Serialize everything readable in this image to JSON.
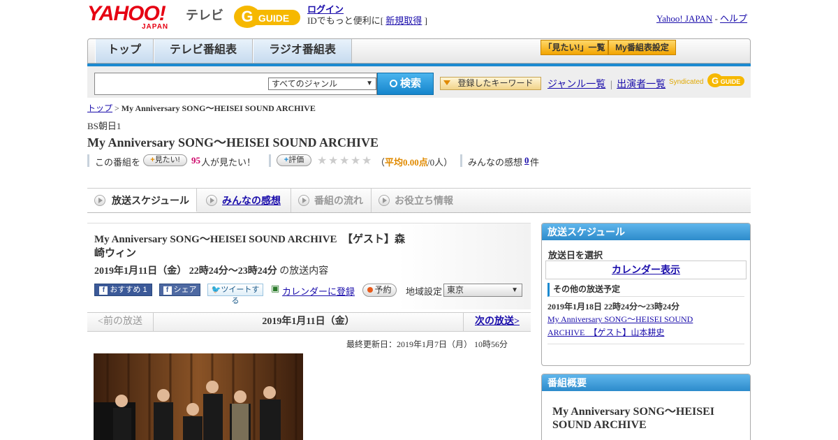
{
  "header": {
    "logo_text": "YAHOO!",
    "logo_sub": "JAPAN",
    "service_label": "テレビ",
    "gguide_label": "GUIDE",
    "login_link": "ログイン",
    "login_note_prefix": "IDでもっと便利に[",
    "signup_link": "新規取得",
    "login_note_suffix": "]",
    "yahoo_japan_link": "Yahoo! JAPAN",
    "link_sep": "-",
    "help_link": "ヘルプ"
  },
  "nav": {
    "tabs": [
      "トップ",
      "テレビ番組表",
      "ラジオ番組表"
    ],
    "want_list": "「見たい!」一覧",
    "my_schedule": "My番組表設定"
  },
  "search": {
    "input_value": "",
    "genre_selected": "すべてのジャンル",
    "search_button": "検索",
    "keyword_button": "登録したキーワード",
    "genre_list_link": "ジャンル一覧",
    "divider": "|",
    "performer_list_link": "出演者一覧",
    "syndicated_label": "Syndicated",
    "syndicated_logo": "GUIDE"
  },
  "breadcrumb": {
    "top": "トップ",
    "sep": ">",
    "current": "My Anniversary SONG～HEISEI SOUND ARCHIVE"
  },
  "program": {
    "station": "BS朝日1",
    "title": "My Anniversary SONG～HEISEI SOUND ARCHIVE",
    "want_prefix": "この番組を",
    "want_button": "見たい!",
    "want_count": "95",
    "want_suffix": "人が見たい！",
    "rate_button": "評価",
    "stars": 0,
    "avg_open": "（",
    "avg_label": "平均0.00点",
    "avg_count": "/0人）",
    "impressions_label": "みんなの感想",
    "impressions_count": "0",
    "impressions_unit": "件"
  },
  "content_tabs": [
    "放送スケジュール",
    "みんなの感想",
    "番組の流れ",
    "お役立ち情報"
  ],
  "episode": {
    "title": "My Anniversary SONG～HEISEI SOUND ARCHIVE　【ゲスト】森崎ウィン",
    "date": "2019年1月11日（金）  22時24分～23時24分",
    "date_suffix": "の放送内容",
    "recommend": "おすすめ",
    "recommend_count": "1",
    "share": "シェア",
    "tweet": "ツイートする",
    "calendar": "カレンダーに登録",
    "reserve": "予約",
    "region_label": "地域設定",
    "region_value": "東京",
    "prev": "<前の放送",
    "current_date": "2019年1月11日（金）",
    "next": "次の放送>",
    "updated": "最終更新日：2019年1月7日（月）  10時56分"
  },
  "sidebar": {
    "schedule_head": "放送スケジュール",
    "select_date": "放送日を選択",
    "calendar_link": "カレンダー表示",
    "other_head": "その他の放送予定",
    "other_date": "2019年1月18日  22時24分～23時24分",
    "other_link": "My Anniversary SONG～HEISEI SOUND ARCHIVE　【ゲスト】山本耕史",
    "summary_head": "番組概要",
    "summary_title": "My Anniversary SONG～HEISEI SOUND ARCHIVE"
  },
  "colors": {
    "accent": "#1c8ad0",
    "link": "#1a0dab",
    "want_count": "#cc0066",
    "avg": "#e08a00"
  }
}
